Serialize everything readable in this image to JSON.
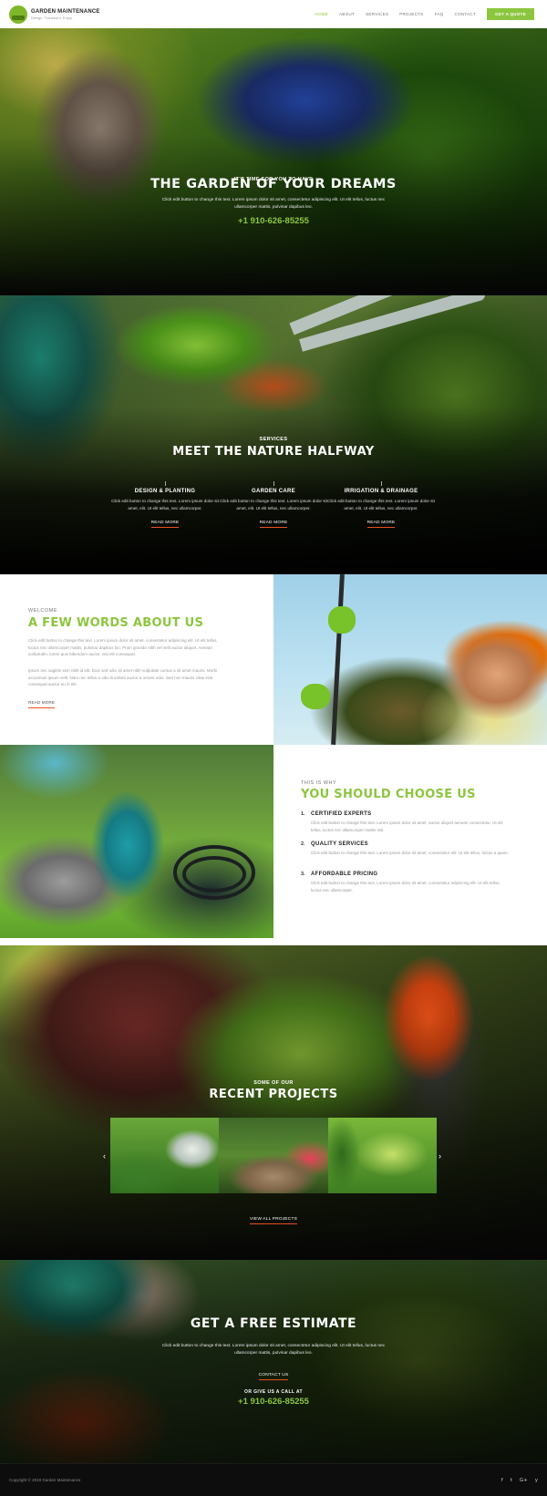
{
  "header": {
    "brand": "GARDEN MAINTENANCE",
    "tagline": "Design. Transform. Enjoy.",
    "nav": [
      "HOME",
      "ABOUT",
      "SERVICES",
      "PROJECTS",
      "FAQ",
      "CONTACT"
    ],
    "active_nav": "HOME",
    "cta": "GET A QUOTE"
  },
  "hero": {
    "eyebrow": "IT'S TIME FOR YOU TO HAVE",
    "title": "THE GARDEN OF YOUR DREAMS",
    "text_line1": "Click edit button to change this text. Lorem ipsum dolor sit amet, consectetur adipiscing elit. Ut elit tellus, luctus nec",
    "text_line2": "ullamcorper mattis, pulvinar dapibus leo.",
    "phone": "+1 910-626-85255"
  },
  "services": {
    "eyebrow": "SERVICES",
    "title": "MEET THE NATURE HALFWAY",
    "items": [
      {
        "title": "DESIGN & PLANTING",
        "text": "Click edit button to change this text. Lorem ipsum dolor sit amet, elit. Ut elit tellus, nec ullamcorper.",
        "link": "READ MORE"
      },
      {
        "title": "GARDEN CARE",
        "text": "Click edit button to change this text. Lorem ipsum dolor sit amet, elit. Ut elit tellus, nec ullamcorper.",
        "link": "READ MORE"
      },
      {
        "title": "IRRIGATION & DRAINAGE",
        "text": "Click edit button to change this text. Lorem ipsum dolor sit amet, elit. Ut elit tellus, nec ullamcorper.",
        "link": "READ MORE"
      }
    ]
  },
  "about": {
    "eyebrow": "WELCOME",
    "title": "A FEW WORDS ABOUT US",
    "para1": "Click edit button to change this text. Lorem ipsum dolor sit amet, consectetur adipiscing elit. Ut elit tellus, luctus nec ullamcorper mattis, pulvinar dapibus leo. Proin gravida nibh vel velit auctor aliquet. Aenean sollicitudin, lorem quis bibendum auctor, nisi elit consequat.",
    "para2": "Ipsum nec sagittis sem nibh id elit. Duis sed odio sit amet nibh vulputate cursus a sit amet mauris. Morbi accumsan ipsum velit. Nam nec tellus a odio tincidunt auctor a ornare odio. Sed non mauris vitae erat consequat auctor eu in elit.",
    "link": "READ MORE"
  },
  "choose": {
    "eyebrow": "THIS IS WHY",
    "title": "YOU SHOULD CHOOSE US",
    "reasons": [
      {
        "num": "1.",
        "title": "CERTIFIED EXPERTS",
        "text": "Click edit button to change this text. Lorem ipsum dolor sit amet, auctor aliquet aenean consectetur. Ut elit tellus, luctus nec ullamcorper mattis nisl."
      },
      {
        "num": "2.",
        "title": "QUALITY SERVICES",
        "text": "Click edit button to change this text. Lorem ipsum dolor sit amet, consectetur elit. Ut elit tellus, luctus a quam."
      },
      {
        "num": "3.",
        "title": "AFFORDABLE PRICING",
        "text": "Click edit button to change this text. Lorem ipsum dolor sit amet, consectetur adipiscing elit. Ut elit tellus, luctus nec ullamcorper."
      }
    ]
  },
  "projects": {
    "eyebrow": "SOME OF OUR",
    "title": "RECENT PROJECTS",
    "prev": "‹",
    "next": "›",
    "link": "VIEW ALL PROJECTS"
  },
  "estimate": {
    "title": "GET A FREE ESTIMATE",
    "text_line1": "Click edit button to change this text. Lorem ipsum dolor sit amet, consectetur adipiscing elit. Ut elit tellus, luctus nec",
    "text_line2": "ullamcorper mattis, pulvinar dapibus leo.",
    "link": "CONTACT US",
    "call_label": "OR GIVE US A CALL AT",
    "phone": "+1 910-626-85255"
  },
  "footer": {
    "copyright": "Copyright © 2019 Garden Maintenance",
    "social": [
      "f",
      "t",
      "G+",
      "y"
    ]
  },
  "colors": {
    "accent": "#8cc63f",
    "link_underline": "#e8501e"
  }
}
